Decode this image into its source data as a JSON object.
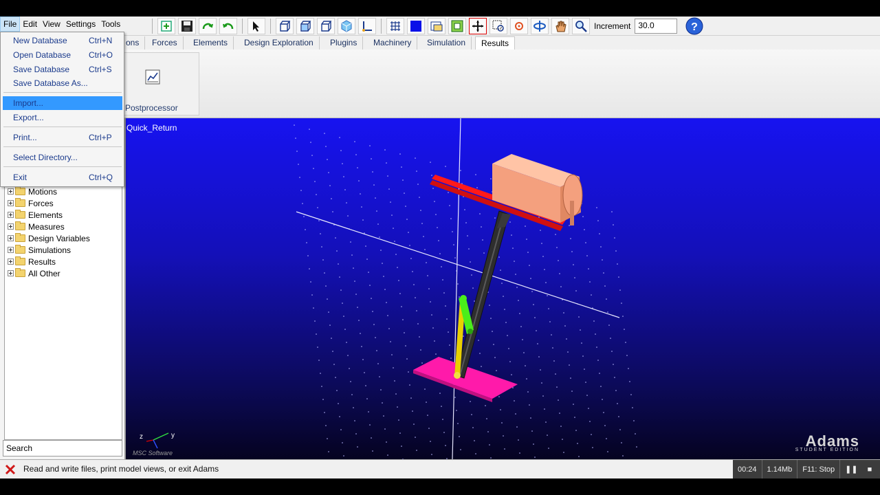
{
  "menubar": {
    "items": [
      "File",
      "Edit",
      "View",
      "Settings",
      "Tools"
    ]
  },
  "toolbar": {
    "increment_label": "Increment",
    "increment_value": "30.0",
    "icons": [
      "add-part-icon",
      "save-icon",
      "redo-icon",
      "undo-icon",
      "select-arrow-icon",
      "view-front-icon",
      "view-right-icon",
      "view-top-icon",
      "view-iso-icon",
      "axis-triad-icon",
      "grid-icon",
      "render-mode-icon",
      "window-icon",
      "fit-icon",
      "zoom-box-icon",
      "center-icon",
      "rotate-icon",
      "pan-hand-icon",
      "zoom-icon"
    ]
  },
  "ribbon": {
    "tabs": [
      "ons",
      "Forces",
      "Elements",
      "Design Exploration",
      "Plugins",
      "Machinery",
      "Simulation",
      "Results"
    ],
    "selected_tab": "Results",
    "group_label": "Postprocessor"
  },
  "file_menu": {
    "items": [
      {
        "label": "New Database",
        "shortcut": "Ctrl+N"
      },
      {
        "label": "Open Database",
        "shortcut": "Ctrl+O"
      },
      {
        "label": "Save Database",
        "shortcut": "Ctrl+S"
      },
      {
        "label": "Save Database As...",
        "shortcut": ""
      },
      {
        "label": "Import...",
        "shortcut": ""
      },
      {
        "label": "Export...",
        "shortcut": ""
      },
      {
        "label": "Print...",
        "shortcut": "Ctrl+P"
      },
      {
        "label": "Select Directory...",
        "shortcut": ""
      },
      {
        "label": "Exit",
        "shortcut": "Ctrl+Q"
      }
    ],
    "highlighted": "Import..."
  },
  "tree": {
    "items": [
      "Motions",
      "Forces",
      "Elements",
      "Measures",
      "Design Variables",
      "Simulations",
      "Results",
      "All Other"
    ]
  },
  "search": {
    "value": "Search"
  },
  "viewport": {
    "model_name": "Quick_Return",
    "triad_z": "z",
    "triad_y": "y",
    "brand": "Adams",
    "brand_edition": "STUDENT EDITION",
    "msc_logo": "MSC Software"
  },
  "statusbar": {
    "message": "Read and write files, print model views, or exit Adams",
    "time": "00:24",
    "memory": "1.14Mb",
    "stop_hint": "F11: Stop"
  },
  "colors": {
    "viewport_top": "#1713f0",
    "viewport_bottom": "#050320",
    "highlight": "#3399ff",
    "rail": "#ff1a1a",
    "slider_block": "#f4a07e",
    "base_plate": "#ff1aaa",
    "crank": "#4aee1a",
    "link": "#333333"
  }
}
